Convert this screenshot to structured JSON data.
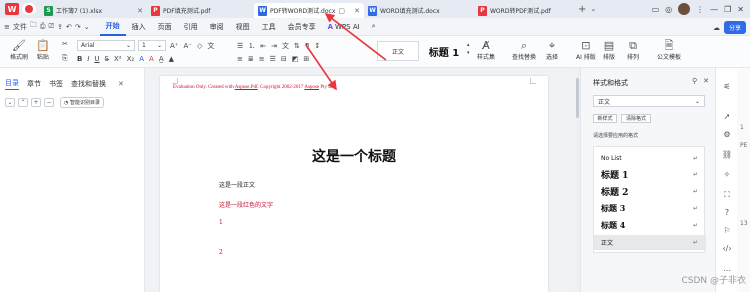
{
  "tabbar": {
    "tabs": [
      {
        "label": "工作簿7 (1).xlsx",
        "icon": "S",
        "icon_color": "#1e9a54"
      },
      {
        "label": "PDF填充测试.pdf",
        "icon": "P",
        "icon_color": "#e8373d"
      },
      {
        "label": "PDF转WORD测试.docx",
        "icon": "W",
        "icon_color": "#2f6be6"
      },
      {
        "label": "WORD填充测试.docx",
        "icon": "W",
        "icon_color": "#2f6be6"
      },
      {
        "label": "WORD转PDF测试.pdf",
        "icon": "P",
        "icon_color": "#e8373d"
      }
    ],
    "add_label": "+",
    "more_label": "⌄"
  },
  "menubar": {
    "file_label": "文件",
    "items": [
      "开始",
      "插入",
      "页面",
      "引用",
      "审阅",
      "视图",
      "工具",
      "会员专享"
    ],
    "active": "开始",
    "wps_ai_label": "WPS AI",
    "share_label": "分享"
  },
  "ribbon": {
    "format_painter": "格式刷",
    "paste": "粘贴",
    "font_name": "Arial",
    "font_size": "1",
    "style_normal": "正文",
    "style_heading1": "标题 1",
    "styles_set": "样式集",
    "find_replace": "查找替换",
    "select": "选择",
    "ai_layout": "AI 排版",
    "layout": "排版",
    "arrange": "排列",
    "doc_assist": "公文模板"
  },
  "left_panel": {
    "tabs": [
      "目录",
      "章节",
      "书签",
      "查找和替换"
    ],
    "active_tab": "目录",
    "generate_toc": "智能识别目录"
  },
  "document": {
    "evaluation_notice": "Evaluation Only. Created with Aspose.Pdf. Copyright 2002-2017 Aspose Pty Ltd.",
    "heading": "这是一个标题",
    "body_text": "这是一段正文",
    "red_text": "这是一段红色的文字",
    "list_1": "1",
    "list_2": "2"
  },
  "right_panel": {
    "title": "样式和格式",
    "current_style": "正文",
    "new_style": "新样式",
    "clear_format": "清除格式",
    "hint": "请选择要应用的格式",
    "styles": [
      {
        "label": "No List",
        "size": 6,
        "bold": false
      },
      {
        "label": "标题 1",
        "size": 9,
        "bold": true
      },
      {
        "label": "标题 2",
        "size": 9,
        "bold": true
      },
      {
        "label": "标题 3",
        "size": 8,
        "bold": true
      },
      {
        "label": "标题 4",
        "size": 8,
        "bold": true
      },
      {
        "label": "正文",
        "size": 6,
        "bold": false
      }
    ],
    "selected_style": "正文"
  },
  "edge_strip": {
    "texts": [
      "1",
      "PE",
      "13"
    ]
  },
  "watermark": "CSDN @子非衣",
  "colors": {
    "accent": "#2761e6",
    "annotation_red": "#e8373d",
    "eval_red": "#c8102e"
  }
}
